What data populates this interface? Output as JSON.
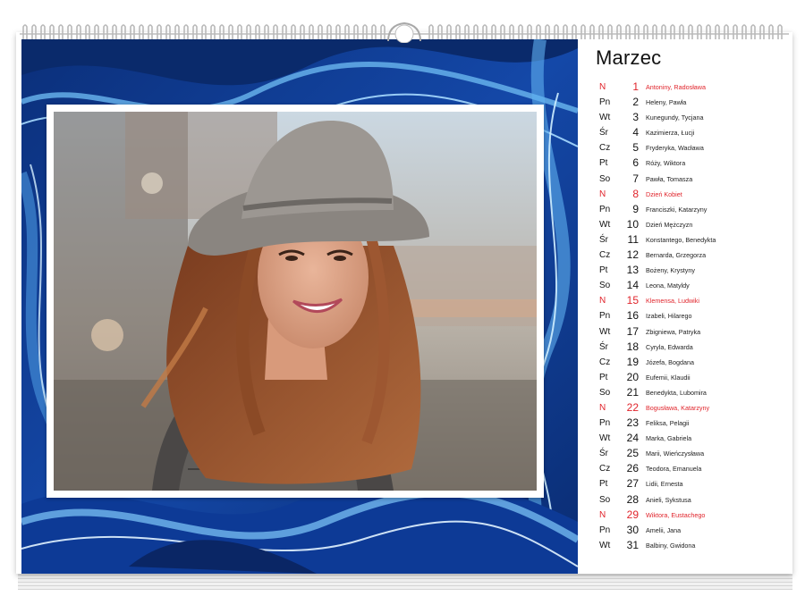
{
  "month": "Marzec",
  "colors": {
    "sunday": "#e0242b",
    "text": "#111111",
    "marble_dark": "#0c3a8f",
    "marble_light": "#5aa9e6"
  },
  "photo": {
    "description_icon": "portrait-photo"
  },
  "days": [
    {
      "dow": "N",
      "num": "1",
      "names": "Antoniny, Radosława",
      "sunday": true
    },
    {
      "dow": "Pn",
      "num": "2",
      "names": "Heleny, Pawła",
      "sunday": false
    },
    {
      "dow": "Wt",
      "num": "3",
      "names": "Kunegundy, Tycjana",
      "sunday": false
    },
    {
      "dow": "Śr",
      "num": "4",
      "names": "Kazimierza, Łucji",
      "sunday": false
    },
    {
      "dow": "Cz",
      "num": "5",
      "names": "Fryderyka, Wacława",
      "sunday": false
    },
    {
      "dow": "Pt",
      "num": "6",
      "names": "Róży, Wiktora",
      "sunday": false
    },
    {
      "dow": "So",
      "num": "7",
      "names": "Pawła, Tomasza",
      "sunday": false
    },
    {
      "dow": "N",
      "num": "8",
      "names": "Dzień Kobiet",
      "sunday": true
    },
    {
      "dow": "Pn",
      "num": "9",
      "names": "Franciszki, Katarzyny",
      "sunday": false
    },
    {
      "dow": "Wt",
      "num": "10",
      "names": "Dzień Mężczyzn",
      "sunday": false
    },
    {
      "dow": "Śr",
      "num": "11",
      "names": "Konstantego, Benedykta",
      "sunday": false
    },
    {
      "dow": "Cz",
      "num": "12",
      "names": "Bernarda, Grzegorza",
      "sunday": false
    },
    {
      "dow": "Pt",
      "num": "13",
      "names": "Bożeny, Krystyny",
      "sunday": false
    },
    {
      "dow": "So",
      "num": "14",
      "names": "Leona, Matyldy",
      "sunday": false
    },
    {
      "dow": "N",
      "num": "15",
      "names": "Klemensa, Ludwiki",
      "sunday": true
    },
    {
      "dow": "Pn",
      "num": "16",
      "names": "Izabeli, Hilarego",
      "sunday": false
    },
    {
      "dow": "Wt",
      "num": "17",
      "names": "Zbigniewa, Patryka",
      "sunday": false
    },
    {
      "dow": "Śr",
      "num": "18",
      "names": "Cyryla, Edwarda",
      "sunday": false
    },
    {
      "dow": "Cz",
      "num": "19",
      "names": "Józefa, Bogdana",
      "sunday": false
    },
    {
      "dow": "Pt",
      "num": "20",
      "names": "Eufemii, Klaudii",
      "sunday": false
    },
    {
      "dow": "So",
      "num": "21",
      "names": "Benedykta, Lubomira",
      "sunday": false
    },
    {
      "dow": "N",
      "num": "22",
      "names": "Bogusława, Katarzyny",
      "sunday": true
    },
    {
      "dow": "Pn",
      "num": "23",
      "names": "Feliksa, Pelagii",
      "sunday": false
    },
    {
      "dow": "Wt",
      "num": "24",
      "names": "Marka, Gabriela",
      "sunday": false
    },
    {
      "dow": "Śr",
      "num": "25",
      "names": "Marii, Wieńczysława",
      "sunday": false
    },
    {
      "dow": "Cz",
      "num": "26",
      "names": "Teodora, Emanuela",
      "sunday": false
    },
    {
      "dow": "Pt",
      "num": "27",
      "names": "Lidii, Ernesta",
      "sunday": false
    },
    {
      "dow": "So",
      "num": "28",
      "names": "Anieli, Sykstusa",
      "sunday": false
    },
    {
      "dow": "N",
      "num": "29",
      "names": "Wiktora, Eustachego",
      "sunday": true
    },
    {
      "dow": "Pn",
      "num": "30",
      "names": "Amelii, Jana",
      "sunday": false
    },
    {
      "dow": "Wt",
      "num": "31",
      "names": "Balbiny, Gwidona",
      "sunday": false
    }
  ]
}
